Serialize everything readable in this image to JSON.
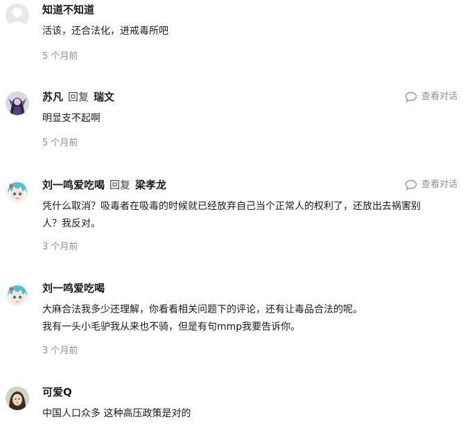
{
  "comments": [
    {
      "author": "知道不知道",
      "reply_label": "",
      "reply_to": "",
      "lines": [
        "活该，还合法化，进戒毒所吧"
      ],
      "time": "5 个月前",
      "show_convo": false,
      "avatar": "default-avatar-icon"
    },
    {
      "author": "苏凡",
      "reply_label": "回复",
      "reply_to": "瑞文",
      "lines": [
        "明显支不起啊"
      ],
      "time": "5 个月前",
      "show_convo": true,
      "avatar": "dark-character-avatar"
    },
    {
      "author": "刘一鸣爱吃喝",
      "reply_label": "回复",
      "reply_to": "梁孝龙",
      "lines": [
        "凭什么取消？吸毒者在吸毒的时候就已经放弃自己当个正常人的权利了，还放出去祸害别",
        "人？我反对。"
      ],
      "time": "3 个月前",
      "show_convo": true,
      "avatar": "anime-teal-hair-avatar"
    },
    {
      "author": "刘一鸣爱吃喝",
      "reply_label": "",
      "reply_to": "",
      "lines": [
        "大麻合法我多少还理解，你看看相关问题下的评论，还有让毒品合法的呢。",
        "我有一头小毛驴我从来也不骑，但是有句mmp我要告诉你。"
      ],
      "time": "3 个月前",
      "show_convo": false,
      "avatar": "anime-teal-hair-avatar"
    },
    {
      "author": "可爱Q",
      "reply_label": "",
      "reply_to": "",
      "lines": [
        "中国人口众多 这种高压政策是对的"
      ],
      "time": "",
      "show_convo": false,
      "avatar": "portrait-avatar"
    }
  ],
  "view_convo_label": "查看对话",
  "colors": {
    "meta": "#8590a6",
    "text": "#1a1a1a"
  }
}
